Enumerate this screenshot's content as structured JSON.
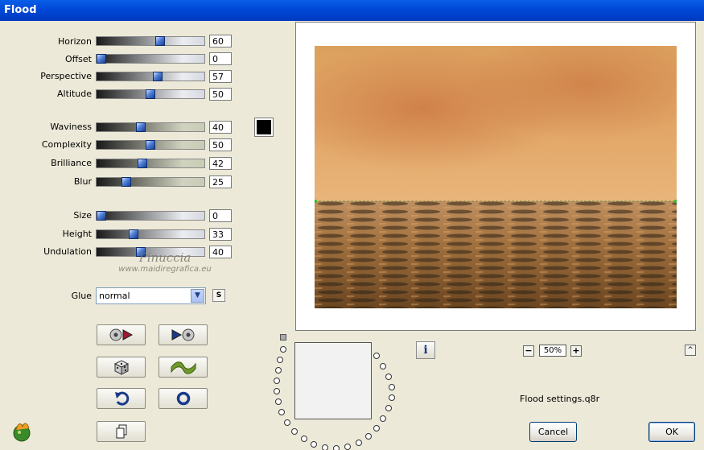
{
  "window": {
    "title": "Flood"
  },
  "sliders": [
    {
      "id": "horizon",
      "label": "Horizon",
      "value": "60",
      "level": 0.6,
      "style": "gA"
    },
    {
      "id": "offset",
      "label": "Offset",
      "value": "0",
      "level": 0.0,
      "style": "gA"
    },
    {
      "id": "perspective",
      "label": "Perspective",
      "value": "57",
      "level": 0.57,
      "style": "gA"
    },
    {
      "id": "altitude",
      "label": "Altitude",
      "value": "50",
      "level": 0.5,
      "style": "gA"
    },
    {
      "id": "waviness",
      "label": "Waviness",
      "value": "40",
      "level": 0.4,
      "style": "gB"
    },
    {
      "id": "complexity",
      "label": "Complexity",
      "value": "50",
      "level": 0.5,
      "style": "gB"
    },
    {
      "id": "brilliance",
      "label": "Brilliance",
      "value": "42",
      "level": 0.42,
      "style": "gB"
    },
    {
      "id": "blur",
      "label": "Blur",
      "value": "25",
      "level": 0.25,
      "style": "gB"
    },
    {
      "id": "size",
      "label": "Size",
      "value": "0",
      "level": 0.0,
      "style": "gA"
    },
    {
      "id": "height",
      "label": "Height",
      "value": "33",
      "level": 0.33,
      "style": "gA"
    },
    {
      "id": "undulation",
      "label": "Undulation",
      "value": "40",
      "level": 0.4,
      "style": "gA"
    }
  ],
  "color_swatch": "#000000",
  "glue": {
    "label": "Glue",
    "value": "normal",
    "s_button": "S"
  },
  "watermark": {
    "line1": "Pinuccia",
    "line2": "www.maidiregrafica.eu"
  },
  "zoom": {
    "value": "50%",
    "minus": "−",
    "plus": "+"
  },
  "status_text": "Flood settings.q8r",
  "buttons": {
    "cancel": "Cancel",
    "ok": "OK",
    "info": "i",
    "up": "^"
  },
  "colors": {
    "sky_light": "#e9b57a",
    "sky_dark": "#c9733f",
    "water_dark": "#2b2015",
    "horizon_line": "#21c421"
  }
}
